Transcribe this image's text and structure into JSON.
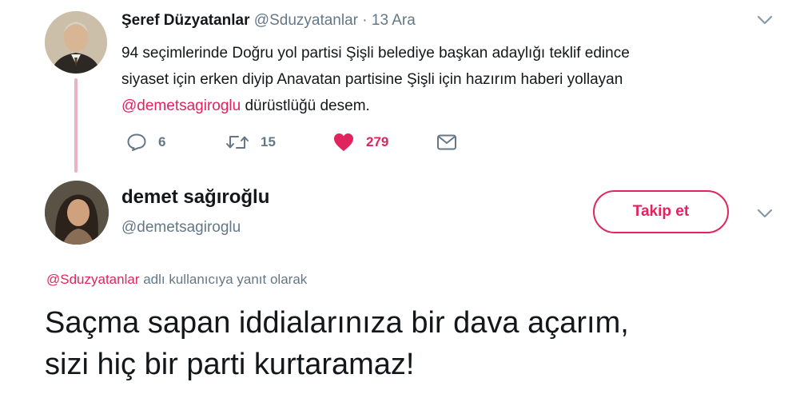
{
  "parent_tweet": {
    "author_name": "Şeref Düzyatanlar",
    "author_handle": "@Sduzyatanlar",
    "separator": "·",
    "date": "13 Ara",
    "text_line_1": "94 seçimlerinde Doğru yol partisi Şişli belediye başkan adaylığı teklif edince",
    "text_line_2": "siyaset için erken diyip Anavatan partisine Şişli için hazırım haberi yollayan",
    "text_mention": "@demetsagiroglu",
    "text_line_3_rest": " dürüstlüğü desem.",
    "actions": {
      "reply_count": "6",
      "retweet_count": "15",
      "like_count": "279"
    }
  },
  "reply_tweet": {
    "author_name": "demet sağıroğlu",
    "author_handle": "@demetsagiroglu",
    "follow_label": "Takip et",
    "replying_to_handle": "@Sduzyatanlar",
    "replying_to_suffix": " adlı kullanıcıya yanıt olarak",
    "text_line_1": "Saçma sapan iddialarınıza bir dava açarım,",
    "text_line_2": "sizi hiç bir parti kurtaramaz!"
  },
  "icons": [
    "chevron-down-icon",
    "reply-icon",
    "retweet-icon",
    "heart-icon",
    "envelope-icon"
  ],
  "colors": {
    "accent": "#e0245e",
    "secondary_text": "#657786",
    "primary_text": "#14171a",
    "thread_line": "#e8b4c2"
  }
}
